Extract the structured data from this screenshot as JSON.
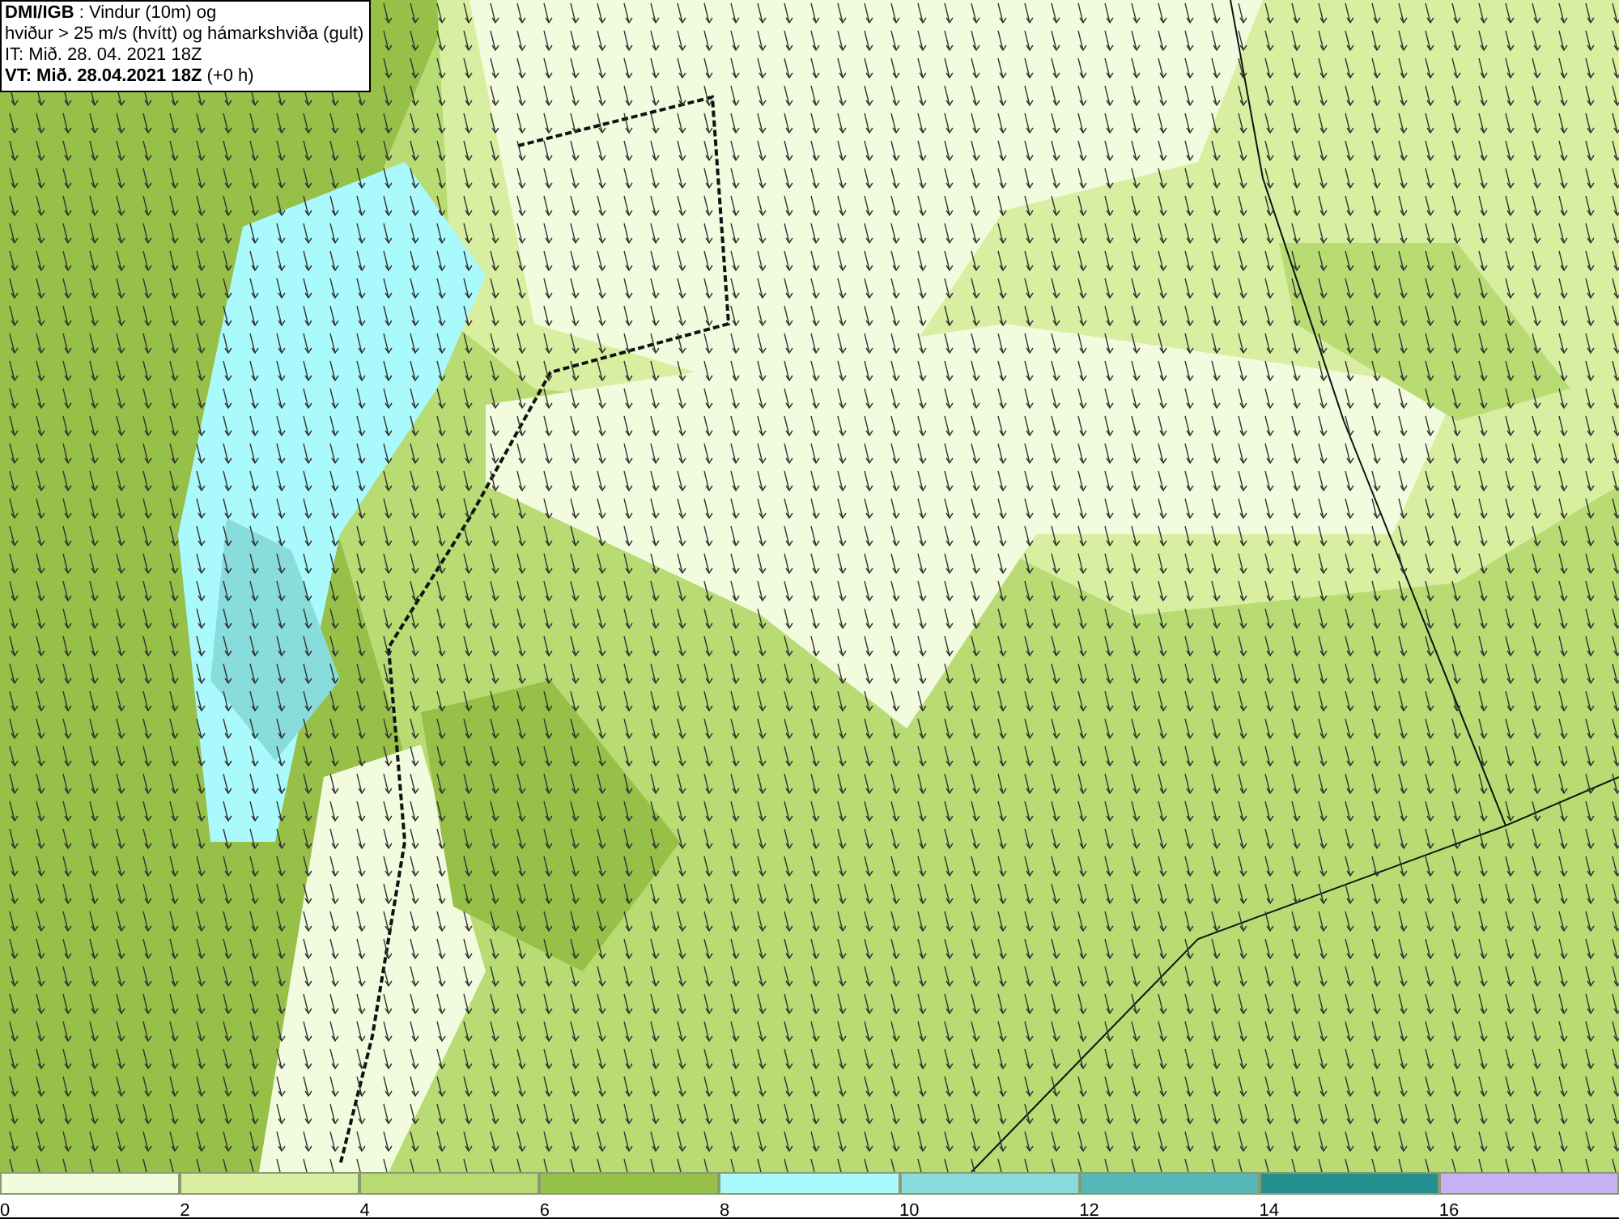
{
  "header": {
    "lines": [
      "**DMI/IGB** : Vindur (10m) og",
      "hviður > 25 m/s (hvítt) og hámarkshviða (gult)",
      "IT: Mið. 28. 04. 2021 18Z",
      "**VT: Mið. 28.04.2021 18Z** (+0 h)"
    ]
  },
  "legend": {
    "bins": [
      {
        "color": "#f3fbdf"
      },
      {
        "color": "#d8eea0"
      },
      {
        "color": "#b8dc73"
      },
      {
        "color": "#97c048"
      },
      {
        "color": "#aaf9fd"
      },
      {
        "color": "#88dcdc"
      },
      {
        "color": "#55b7b7"
      },
      {
        "color": "#248f8f"
      },
      {
        "color": "#c4b2f5"
      }
    ],
    "ticks": [
      "0",
      "2",
      "4",
      "6",
      "8",
      "10",
      "12",
      "14",
      "16"
    ]
  }
}
